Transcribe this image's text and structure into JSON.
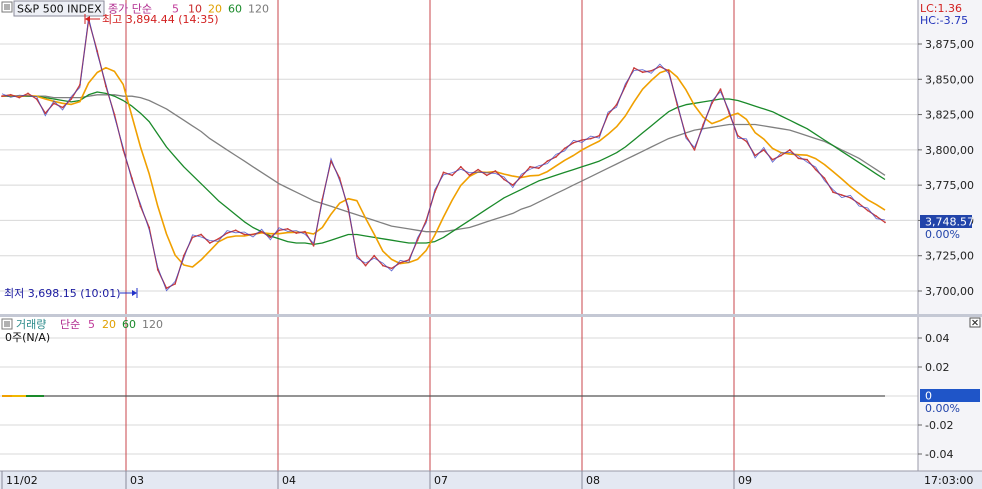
{
  "colors": {
    "background": "#ffffff",
    "grid": "#d8d8d8",
    "session_line": "#c8464b",
    "axis_bg": "#f0f0f4",
    "bottom_axis_bg": "#e2e6f2",
    "price": "#c83c3c",
    "price_alt": "#3444c8",
    "ma5": "#f0a000",
    "ma10": "#d04020",
    "ma20": "#f0b800",
    "ma60": "#1a8a2a",
    "ma120": "#808080",
    "last_label_bg": "#2244aa",
    "high_marker": "#d22020",
    "low_marker": "#2030c8",
    "vol_zero_bg": "#1f55c8"
  },
  "price_panel": {
    "symbol_button": "S&P 500 INDEX",
    "indicator_label": "종가 단순",
    "ma_periods": [
      "5",
      "10",
      "20",
      "60",
      "120"
    ],
    "lc_label": "LC:1.36",
    "hc_label": "HC:-3.75",
    "high_annotation": "최고 3,894.44 (14:35)",
    "low_annotation": "최저 3,698.15 (10:01)",
    "last_price": "3,748.57",
    "last_change": "0.00%"
  },
  "volume_panel": {
    "title": "거래량",
    "indicator_label": "단순",
    "ma_periods": [
      "5",
      "20",
      "60",
      "120"
    ],
    "value_text": "0주(N/A)",
    "zero_label": "0",
    "zero_pct": "0.00%",
    "close_icon": "close-icon"
  },
  "x_axis": {
    "labels": [
      "11/02",
      "03",
      "04",
      "07",
      "08",
      "09"
    ],
    "time": "17:03:00"
  },
  "chart_data": {
    "type": "line",
    "title": "S&P 500 INDEX",
    "series": [
      {
        "name": "종가",
        "values": [
          3838,
          3839,
          3837,
          3840,
          3836,
          3826,
          3833,
          3830,
          3836,
          3846,
          3892,
          3870,
          3845,
          3825,
          3800,
          3780,
          3760,
          3745,
          3715,
          3702,
          3705,
          3725,
          3738,
          3740,
          3734,
          3737,
          3741,
          3743,
          3740,
          3740,
          3742,
          3738,
          3743,
          3744,
          3741,
          3742,
          3732,
          3765,
          3792,
          3780,
          3758,
          3725,
          3718,
          3725,
          3718,
          3716,
          3720,
          3722,
          3736,
          3750,
          3770,
          3784,
          3782,
          3788,
          3782,
          3786,
          3782,
          3785,
          3779,
          3775,
          3781,
          3788,
          3787,
          3792,
          3795,
          3801,
          3805,
          3807,
          3808,
          3810,
          3825,
          3832,
          3845,
          3858,
          3855,
          3856,
          3859,
          3856,
          3832,
          3810,
          3800,
          3818,
          3833,
          3843,
          3826,
          3810,
          3806,
          3796,
          3800,
          3793,
          3796,
          3800,
          3794,
          3793,
          3786,
          3780,
          3770,
          3768,
          3766,
          3762,
          3757,
          3753,
          3748.57
        ]
      },
      {
        "name": "5",
        "values": [
          3838,
          3838.5,
          3838,
          3838.5,
          3838,
          3836,
          3834.4,
          3833,
          3832.2,
          3834.2,
          3847.4,
          3854.8,
          3858.2,
          3855.6,
          3846.4,
          3824,
          3802,
          3783,
          3760,
          3740.4,
          3725.4,
          3718.4,
          3717,
          3722,
          3728.4,
          3734.8,
          3738,
          3739,
          3739,
          3740.2,
          3741.2,
          3740.6,
          3740.6,
          3741.4,
          3741.6,
          3741.6,
          3740.4,
          3745,
          3754.4,
          3762.2,
          3765.4,
          3764,
          3751.6,
          3740.2,
          3728.2,
          3722.4,
          3719.4,
          3720.2,
          3722.4,
          3728.8,
          3739.6,
          3752.4,
          3764.4,
          3774.8,
          3781.2,
          3784.4,
          3784,
          3784.6,
          3782.8,
          3781.4,
          3780.4,
          3781.6,
          3782,
          3784.6,
          3788.6,
          3792.6,
          3796,
          3800,
          3803.2,
          3806.2,
          3811,
          3816.4,
          3824,
          3834,
          3843,
          3849.2,
          3854.6,
          3856.8,
          3851.6,
          3842.6,
          3831.4,
          3823.2,
          3818.6,
          3820.8,
          3824,
          3826,
          3821.6,
          3812.2,
          3807.6,
          3801,
          3798,
          3797,
          3796.6,
          3796.2,
          3793.8,
          3789.6,
          3784.6,
          3779.4,
          3774,
          3769.2,
          3764.6,
          3761.2,
          3757.3
        ]
      },
      {
        "name": "20",
        "values": [
          3838,
          3838,
          3838,
          3838,
          3838,
          3837,
          3836,
          3835,
          3834,
          3835,
          3839,
          3841,
          3840,
          3838,
          3835,
          3831,
          3826,
          3820,
          3811,
          3802,
          3795,
          3788,
          3782,
          3776,
          3770,
          3764,
          3759,
          3754,
          3749,
          3745,
          3742,
          3739,
          3737,
          3735,
          3734,
          3734,
          3733,
          3734,
          3736,
          3738,
          3740,
          3740,
          3739,
          3738,
          3737,
          3736,
          3735,
          3734,
          3734,
          3734,
          3735,
          3738,
          3742,
          3746,
          3750,
          3754,
          3758,
          3762,
          3766,
          3769,
          3772,
          3775,
          3778,
          3780,
          3782,
          3784,
          3786,
          3788,
          3790,
          3792,
          3795,
          3798,
          3802,
          3807,
          3812,
          3817,
          3822,
          3827,
          3830,
          3832,
          3833,
          3834,
          3835,
          3836,
          3836,
          3835,
          3833,
          3831,
          3829,
          3827,
          3824,
          3821,
          3818,
          3815,
          3811,
          3807,
          3803,
          3799,
          3795,
          3791,
          3787,
          3783,
          3779
        ]
      },
      {
        "name": "60",
        "values": [
          3838,
          3838,
          3838,
          3838,
          3838,
          3838,
          3837,
          3837,
          3837,
          3837,
          3838,
          3839,
          3839,
          3839,
          3838,
          3838,
          3837,
          3835,
          3832,
          3829,
          3825,
          3821,
          3817,
          3813,
          3808,
          3804,
          3800,
          3796,
          3792,
          3788,
          3784,
          3780,
          3776,
          3773,
          3770,
          3767,
          3764,
          3762,
          3760,
          3758,
          3756,
          3754,
          3752,
          3750,
          3748,
          3746,
          3745,
          3744,
          3743,
          3742,
          3742,
          3742,
          3743,
          3744,
          3745,
          3747,
          3749,
          3751,
          3753,
          3755,
          3758,
          3760,
          3763,
          3766,
          3769,
          3772,
          3775,
          3778,
          3781,
          3784,
          3787,
          3790,
          3793,
          3796,
          3799,
          3802,
          3805,
          3808,
          3810,
          3812,
          3814,
          3815,
          3816,
          3817,
          3818,
          3818,
          3818,
          3818,
          3817,
          3816,
          3815,
          3814,
          3812,
          3810,
          3808,
          3806,
          3803,
          3800,
          3797,
          3794,
          3790,
          3786,
          3782
        ]
      }
    ],
    "y_ticks": [
      "3,700,00",
      "3,725,00",
      "3,750,00",
      "3,775,00",
      "3,800,00",
      "3,825,00",
      "3,850,00",
      "3,875,00"
    ],
    "volume_y_ticks": [
      "0.04",
      "0.02",
      "0",
      "-0.02",
      "-0.04"
    ],
    "ylim": [
      3680,
      3905
    ],
    "volume_ylim": [
      -0.055,
      0.055
    ],
    "x_labels": [
      "11/02",
      "03",
      "04",
      "07",
      "08",
      "09"
    ],
    "grid": true
  }
}
